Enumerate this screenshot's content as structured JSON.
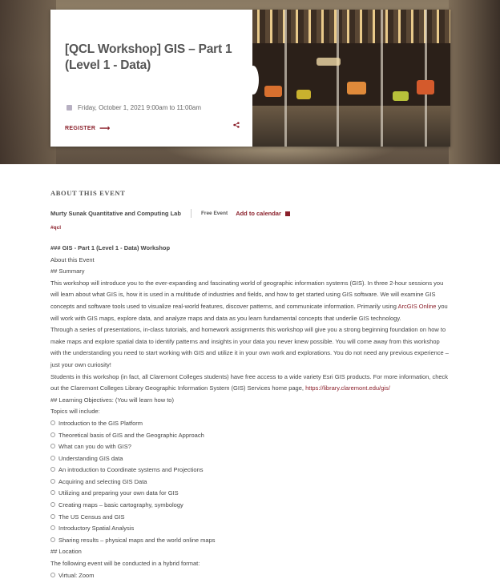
{
  "hero": {
    "title": "[QCL Workshop] GIS – Part 1 (Level 1 - Data)",
    "date": "Friday, October 1, 2021 9:00am to 11:00am",
    "register_label": "REGISTER",
    "share_icon": "share-icon",
    "calendar_icon": "calendar-icon"
  },
  "about": {
    "heading": "ABOUT THIS EVENT",
    "organizer": "Murty Sunak Quantitative and Computing Lab",
    "price": "Free Event",
    "add_to_calendar": "Add to calendar",
    "tag": "#qcl"
  },
  "content": {
    "line1": "### GIS - Part 1 (Level 1 - Data) Workshop",
    "line2": "About this Event",
    "line3": "## Summary",
    "summary_a": "This workshop will introduce you to the ever-expanding and fascinating world of geographic information systems (GIS). In three 2-hour sessions you will learn about what GIS is, how it is used in a multitude of industries and fields, and how to get started using GIS software. We will examine GIS concepts and software tools used to visualize real-world features, discover patterns, and communicate information. Primarily using ",
    "arcgis_link": "ArcGIS Online",
    "summary_b": " you will work with GIS maps, explore data, and analyze maps and data as you learn fundamental concepts that underlie GIS technology.",
    "para2": "Through a series of presentations, in-class tutorials, and homework assignments this workshop will give you a strong beginning foundation on how to make maps and explore spatial data to identify patterns and insights in your data you never knew possible. You will come away from this workshop with the understanding you need to start working with GIS and utilize it in your own work and explorations. You do not need any previous experience – just your own curiosity!",
    "para3": "Students in this workshop (in fact, all Claremont Colleges students) have free access to a wide variety Esri GIS products. For more information, check out the Claremont Colleges Library Geographic Information System (GIS) Services home page, ",
    "gis_link": "https://library.claremont.edu/gis/",
    "objectives": "## Learning Objectives: (You will learn how to)",
    "topics_intro": "Topics will include:",
    "topics": [
      "Introduction to the GIS Platform",
      "Theoretical basis of GIS and the Geographic Approach",
      "What can you do with GIS?",
      "Understanding GIS data",
      "An introduction to Coordinate systems and Projections",
      "Acquiring and selecting GIS Data",
      "Utilizing and preparing your own data for GIS",
      "Creating maps – basic cartography, symbology",
      "The US Census and GIS",
      "Introductory Spatial Analysis",
      "Sharing results – physical maps and the world online maps"
    ],
    "location_h": "## Location",
    "location_text": "The following event will be conducted in a hybrid format:",
    "location_items": [
      "Virtual: Zoom"
    ]
  }
}
